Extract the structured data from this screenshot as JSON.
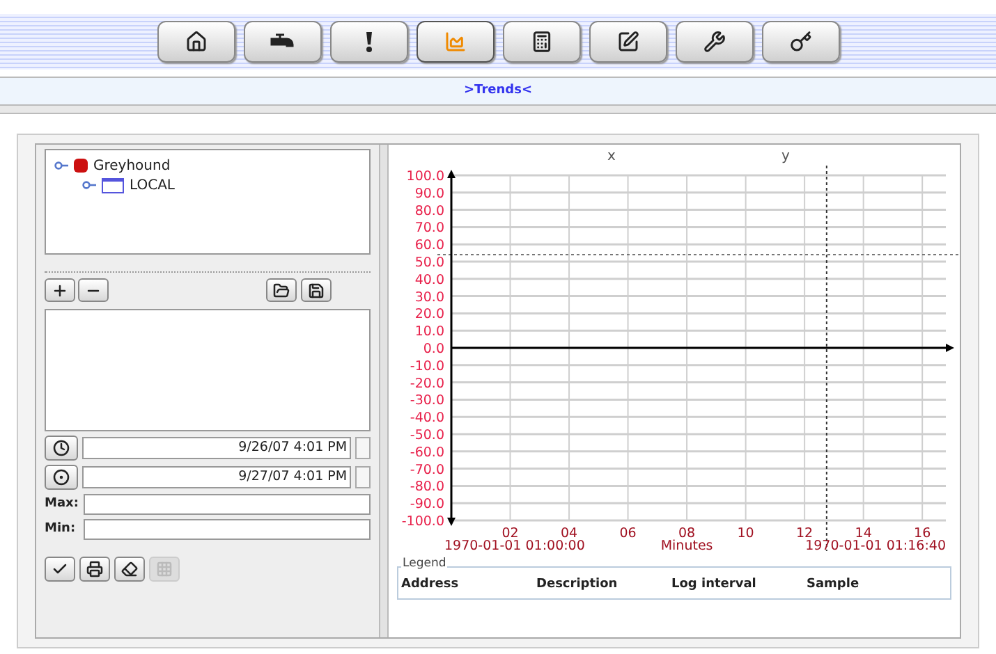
{
  "toolbar": {
    "buttons": [
      {
        "kind": "home",
        "selected": false
      },
      {
        "kind": "faucet",
        "selected": false
      },
      {
        "kind": "alert",
        "selected": false
      },
      {
        "kind": "trends",
        "selected": true
      },
      {
        "kind": "calculator",
        "selected": false
      },
      {
        "kind": "edit",
        "selected": false
      },
      {
        "kind": "wrench",
        "selected": false
      },
      {
        "kind": "key",
        "selected": false
      }
    ]
  },
  "title": ">Trends<",
  "tree": [
    {
      "label": "Greyhound",
      "kind": "database",
      "children": [
        {
          "label": "LOCAL",
          "kind": "window"
        }
      ]
    }
  ],
  "list_buttons": [
    {
      "kind": "plus"
    },
    {
      "kind": "minus"
    },
    {
      "kind": "open"
    },
    {
      "kind": "save"
    }
  ],
  "time_range": [
    {
      "kind": "start",
      "value": "9/26/07 4:01 PM"
    },
    {
      "kind": "end",
      "value": "9/27/07 4:01 PM"
    }
  ],
  "limits": [
    {
      "label": "Max:"
    },
    {
      "label": "Min:"
    }
  ],
  "action_buttons": [
    {
      "kind": "check",
      "disabled": false
    },
    {
      "kind": "print",
      "disabled": false
    },
    {
      "kind": "eraser",
      "disabled": false
    },
    {
      "kind": "grid",
      "disabled": true
    }
  ],
  "chart": {
    "cursor_labels": [
      "x",
      "y"
    ],
    "start_time": "1970-01-01 01:00:00",
    "end_time": "1970-01-01 01:16:40",
    "chart_data": {
      "type": "line",
      "grid": true,
      "ref_lines": [
        {
          "axis": "x",
          "value": 12.75
        },
        {
          "axis": "y",
          "value": 54
        }
      ],
      "xlabel": "Minutes",
      "xlim": [
        0,
        16.8
      ],
      "ylim": [
        -100,
        100
      ],
      "xticks": [
        {
          "value": 2,
          "label": "02"
        },
        {
          "value": 4,
          "label": "04"
        },
        {
          "value": 6,
          "label": "06"
        },
        {
          "value": 8,
          "label": "08"
        },
        {
          "value": 10,
          "label": "10"
        },
        {
          "value": 12,
          "label": "12"
        },
        {
          "value": 14,
          "label": "14"
        },
        {
          "value": 16,
          "label": "16"
        }
      ],
      "yticks": [
        {
          "value": 100,
          "label": "100.0"
        },
        {
          "value": 90,
          "label": "90.0"
        },
        {
          "value": 80,
          "label": "80.0"
        },
        {
          "value": 70,
          "label": "70.0"
        },
        {
          "value": 60,
          "label": "60.0"
        },
        {
          "value": 50,
          "label": "50.0"
        },
        {
          "value": 40,
          "label": "40.0"
        },
        {
          "value": 30,
          "label": "30.0"
        },
        {
          "value": 20,
          "label": "20.0"
        },
        {
          "value": 10,
          "label": "10.0"
        },
        {
          "value": 0,
          "label": "0.0"
        },
        {
          "value": -10,
          "label": "-10.0"
        },
        {
          "value": -20,
          "label": "-20.0"
        },
        {
          "value": -30,
          "label": "-30.0"
        },
        {
          "value": -40,
          "label": "-40.0"
        },
        {
          "value": -50,
          "label": "-50.0"
        },
        {
          "value": -60,
          "label": "-60.0"
        },
        {
          "value": -70,
          "label": "-70.0"
        },
        {
          "value": -80,
          "label": "-80.0"
        },
        {
          "value": -90,
          "label": "-90.0"
        },
        {
          "value": -100,
          "label": "-100.0"
        }
      ]
    },
    "legend": {
      "title": "Legend",
      "columns": [
        "Address",
        "Description",
        "Log interval",
        "Sample"
      ]
    }
  }
}
